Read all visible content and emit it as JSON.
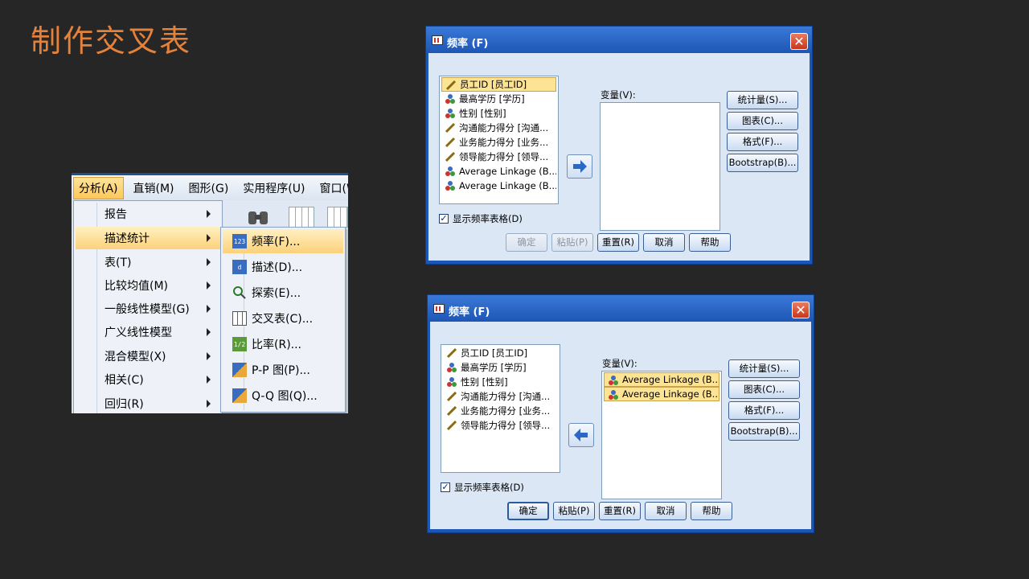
{
  "slide_title": "制作交叉表",
  "menu_shot": {
    "menubar": [
      "分析(A)",
      "直销(M)",
      "图形(G)",
      "实用程序(U)",
      "窗口(W"
    ],
    "dropdown": [
      "报告",
      "描述统计",
      "表(T)",
      "比较均值(M)",
      "一般线性模型(G)",
      "广义线性模型",
      "混合模型(X)",
      "相关(C)",
      "回归(R)"
    ],
    "submenu": [
      "频率(F)...",
      "描述(D)...",
      "探索(E)...",
      "交叉表(C)...",
      "比率(R)...",
      "P-P 图(P)...",
      "Q-Q 图(Q)..."
    ],
    "submenu_icons": [
      "123",
      "d",
      "",
      "",
      "1/2",
      "",
      ""
    ]
  },
  "dialog1": {
    "title": "频率 (F)",
    "close": "✕",
    "source_items": [
      "员工ID [员工ID]",
      "最高学历 [学历]",
      "性别 [性别]",
      "沟通能力得分 [沟通...",
      "业务能力得分 [业务...",
      "领导能力得分 [领导...",
      "Average Linkage (B...",
      "Average Linkage (B..."
    ],
    "target_items": [],
    "variables_label": "变量(V):",
    "side_buttons": [
      "统计量(S)...",
      "图表(C)...",
      "格式(F)...",
      "Bootstrap(B)..."
    ],
    "checkbox_label": "显示频率表格(D)",
    "checkbox_mark": "✓",
    "bottom_buttons": [
      "确定",
      "粘贴(P)",
      "重置(R)",
      "取消",
      "帮助"
    ]
  },
  "dialog2": {
    "title": "频率 (F)",
    "close": "✕",
    "source_items": [
      "员工ID [员工ID]",
      "最高学历 [学历]",
      "性别 [性别]",
      "沟通能力得分 [沟通...",
      "业务能力得分 [业务...",
      "领导能力得分 [领导..."
    ],
    "target_items": [
      "Average Linkage (B...",
      "Average Linkage (B..."
    ],
    "variables_label": "变量(V):",
    "side_buttons": [
      "统计量(S)...",
      "图表(C)...",
      "格式(F)...",
      "Bootstrap(B)..."
    ],
    "checkbox_label": "显示频率表格(D)",
    "checkbox_mark": "✓",
    "bottom_buttons": [
      "确定",
      "粘贴(P)",
      "重置(R)",
      "取消",
      "帮助"
    ]
  },
  "colors": {
    "title": "#e4823b",
    "dialog_frame": "#1a57b8",
    "highlight": "#fde394"
  }
}
